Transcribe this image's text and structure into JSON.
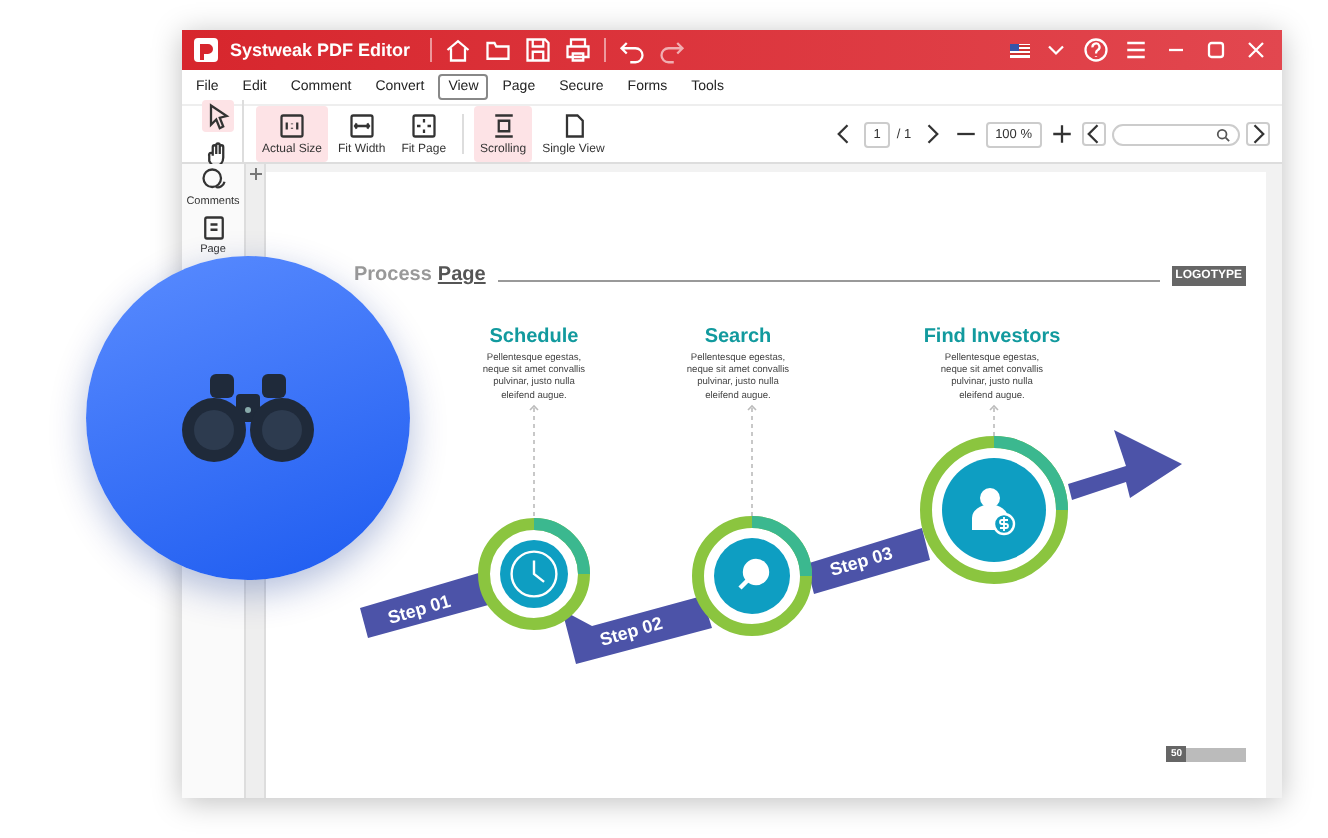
{
  "window": {
    "title": "Systweak PDF Editor"
  },
  "menu": [
    {
      "label": "File",
      "selected": false
    },
    {
      "label": "Edit",
      "selected": false
    },
    {
      "label": "Comment",
      "selected": false
    },
    {
      "label": "Convert",
      "selected": false
    },
    {
      "label": "View",
      "selected": true
    },
    {
      "label": "Page",
      "selected": false
    },
    {
      "label": "Secure",
      "selected": false
    },
    {
      "label": "Forms",
      "selected": false
    },
    {
      "label": "Tools",
      "selected": false
    }
  ],
  "tools": [
    {
      "kind": "pointer",
      "selected": true
    },
    {
      "kind": "hand",
      "selected": false
    }
  ],
  "view_buttons": [
    {
      "label": "Actual Size",
      "kind": "actual-size",
      "selected": true
    },
    {
      "label": "Fit Width",
      "kind": "fit-width",
      "selected": false
    },
    {
      "label": "Fit Page",
      "kind": "fit-page",
      "selected": false
    },
    {
      "label": "Scrolling",
      "kind": "scrolling",
      "selected": true
    },
    {
      "label": "Single View",
      "kind": "single-view",
      "selected": false
    }
  ],
  "page_nav": {
    "page": "1",
    "total": "/ 1"
  },
  "zoom": {
    "value": "100 %"
  },
  "sidebar": [
    {
      "label": "Comments",
      "kind": "comments"
    },
    {
      "label": "Page",
      "kind": "page"
    }
  ],
  "document": {
    "heading_light": "Process",
    "heading_bold": "Page",
    "logo": "LOGOTYPE",
    "steps": [
      {
        "title": "Schedule",
        "description": "Pellentesque egestas,\nneque sit amet convallis\npulvinar, justo nulla\neleifend augue.",
        "label": "Step 01",
        "kind": "clock"
      },
      {
        "title": "Search",
        "description": "Pellentesque egestas,\nneque sit amet convallis\npulvinar, justo nulla\neleifend augue.",
        "label": "Step 02",
        "kind": "search"
      },
      {
        "title": "Find Investors",
        "description": "Pellentesque egestas,\nneque sit amet convallis\npulvinar, justo nulla\neleifend augue.",
        "label": "Step 03",
        "kind": "investor"
      }
    ],
    "page_number": "50"
  }
}
